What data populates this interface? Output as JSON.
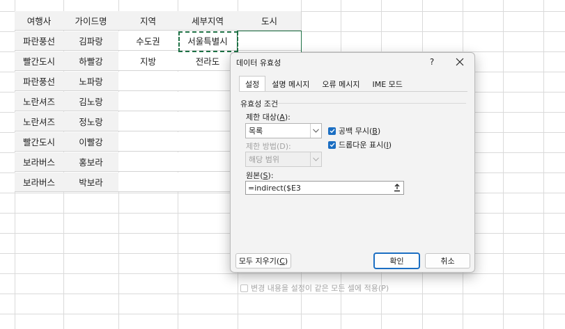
{
  "sheet": {
    "columns": [
      {
        "header": "여행사",
        "cells": [
          "파란풍선",
          "빨간도시",
          "파란풍선",
          "노란셔즈",
          "노란셔즈",
          "빨간도시",
          "보라버스",
          "보라버스"
        ]
      },
      {
        "header": "가이드명",
        "cells": [
          "김파랑",
          "하빨강",
          "노파랑",
          "김노랑",
          "정노랑",
          "이빨강",
          "홍보라",
          "박보라"
        ]
      },
      {
        "header": "지역",
        "cells": [
          "수도권",
          "지방",
          "",
          "",
          "",
          "",
          "",
          ""
        ]
      },
      {
        "header": "세부지역",
        "cells": [
          "서울특별시",
          "전라도",
          "",
          "",
          "",
          "",
          "",
          ""
        ]
      },
      {
        "header": "도시",
        "cells": [
          "",
          "",
          "",
          "",
          "",
          "",
          "",
          ""
        ]
      }
    ]
  },
  "dialog": {
    "title": "데이터 유효성",
    "help": "?",
    "tabs": [
      {
        "label": "설정",
        "active": true
      },
      {
        "label": "설명 메시지",
        "active": false
      },
      {
        "label": "오류 메시지",
        "active": false
      },
      {
        "label": "IME 모드",
        "active": false
      }
    ],
    "section_title": "유효성 조건",
    "allow_label_prefix": "제한 대상(",
    "allow_label_key": "A",
    "allow_label_suffix": "):",
    "allow_value": "목록",
    "ignore_blank_prefix": "공백 무시(",
    "ignore_blank_key": "B",
    "ignore_blank_suffix": ")",
    "ignore_blank_checked": true,
    "dropdown_prefix": "드롭다운 표시(",
    "dropdown_key": "I",
    "dropdown_suffix": ")",
    "dropdown_checked": true,
    "data_label": "제한 방법(D):",
    "data_value": "해당 범위",
    "source_label_prefix": "원본(",
    "source_label_key": "S",
    "source_label_suffix": "):",
    "source_value": "=indirect($E3",
    "apply_all_label": "변경 내용을 설정이 같은 모든 셀에 적용(P)",
    "apply_all_checked": false,
    "clear_all_prefix": "모두 지우기(",
    "clear_all_key": "C",
    "clear_all_suffix": ")",
    "ok_label": "확인",
    "cancel_label": "취소"
  },
  "colors": {
    "accent": "#1b6ec2",
    "selection": "#1e7145",
    "data_fill": "#f2f2f2"
  },
  "icons": {
    "close": "close-icon",
    "dropdown": "chevron-down-icon",
    "check": "checkmark-icon",
    "collapse": "collapse-dialog-icon"
  }
}
